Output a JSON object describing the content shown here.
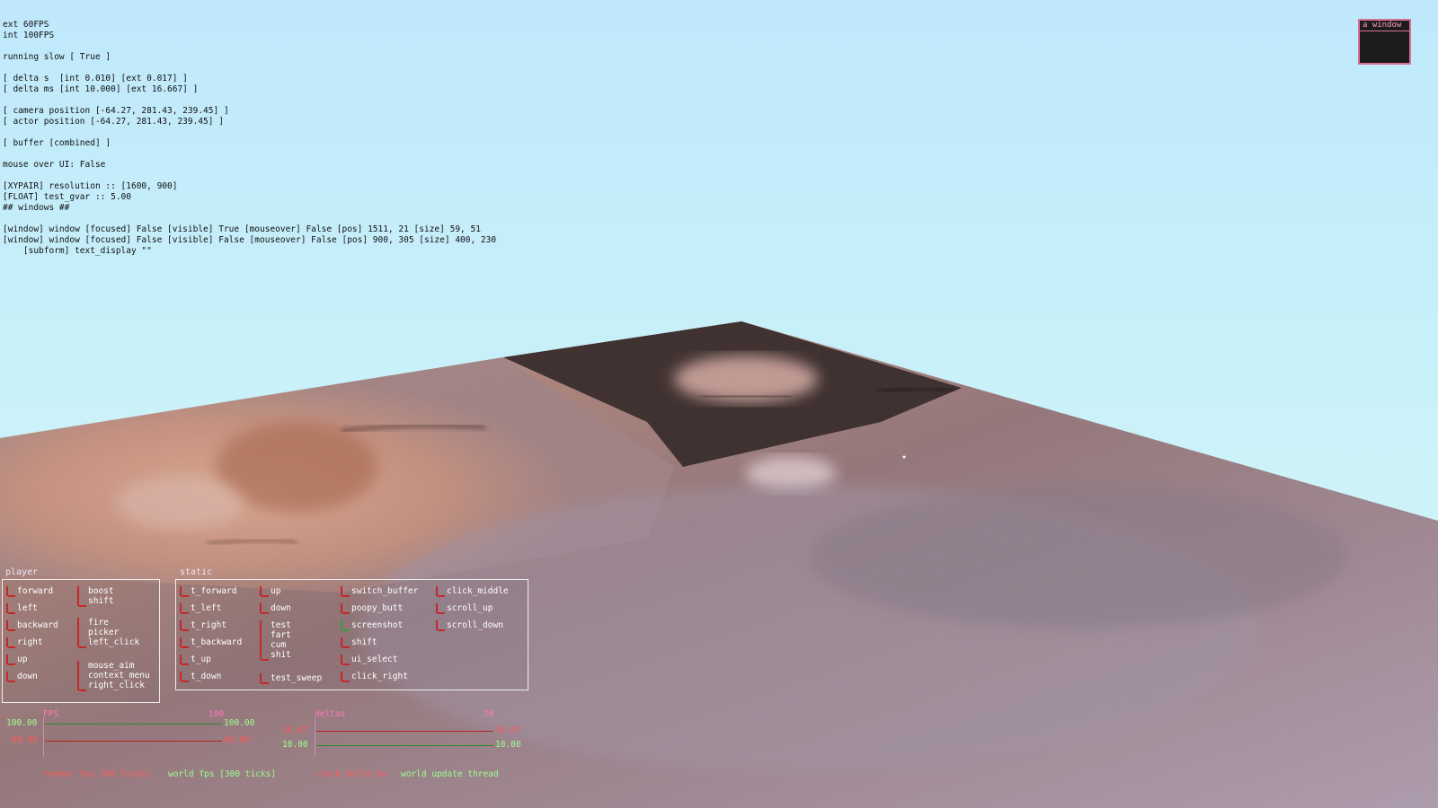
{
  "debug_lines": [
    "ext 60FPS",
    "int 100FPS",
    "",
    "running slow [ True ]",
    "",
    "[ delta s  [int 0.010] [ext 0.017] ]",
    "[ delta ms [int 10.000] [ext 16.667] ]",
    "",
    "[ camera position [-64.27, 281.43, 239.45] ]",
    "[ actor position [-64.27, 281.43, 239.45] ]",
    "",
    "[ buffer [combined] ]",
    "",
    "mouse over UI: False",
    "",
    "[XYPAIR] resolution :: [1600, 900]",
    "[FLOAT] test_gvar :: 5.00",
    "## windows ##",
    "",
    "[window] window [focused] False [visible] True [mouseover] False [pos] 1511, 21 [size] 59, 51",
    "[window] window [focused] False [visible] False [mouseover] False [pos] 900, 305 [size] 400, 230",
    "    [subform] text_display \"\""
  ],
  "mini_window": {
    "title": "a window"
  },
  "player_panel": {
    "label": "player",
    "left_column": [
      "forward",
      "left",
      "backward",
      "right",
      "up",
      "down"
    ],
    "right_column": [
      {
        "text": "boost\nshift"
      },
      {
        "text": "fire\npicker\nleft_click"
      },
      {
        "text": "mouse_aim\ncontext_menu\nright_click"
      }
    ]
  },
  "static_panel": {
    "label": "static",
    "col1": [
      "t_forward",
      "t_left",
      "t_right",
      "t_backward",
      "t_up",
      "t_down"
    ],
    "col2": [
      {
        "text": "up"
      },
      {
        "text": "down"
      },
      {
        "text": "test\nfart\ncum\nshit"
      },
      {
        "text": "test_sweep"
      }
    ],
    "col3": [
      {
        "text": "switch_buffer",
        "active": false
      },
      {
        "text": "poopy_butt",
        "active": false
      },
      {
        "text": "screenshot",
        "active": true
      },
      {
        "text": "shift",
        "active": false
      },
      {
        "text": "ui_select",
        "active": false
      },
      {
        "text": "click_right",
        "active": false
      }
    ],
    "col4": [
      "click_middle",
      "scroll_up",
      "scroll_down"
    ]
  },
  "fps_graph": {
    "title": "FPS",
    "max_label": "100",
    "rows": [
      {
        "left": "100.00",
        "right": "100.00",
        "color": "#9bff8f"
      },
      {
        "left": "60.00",
        "right": "60.00",
        "color": "#ff5a5a"
      }
    ],
    "footer": [
      "render fps [60 ticks]",
      "world fps [300 ticks]"
    ]
  },
  "deltas_graph": {
    "title": "deltas",
    "max_label": "20",
    "rows": [
      {
        "left": "16.67",
        "right": "16.67",
        "color": "#ff5a5a"
      },
      {
        "left": "10.00",
        "right": "10.00",
        "color": "#9bff8f"
      }
    ],
    "footer": [
      "clock delta ms",
      "world update thread"
    ]
  }
}
